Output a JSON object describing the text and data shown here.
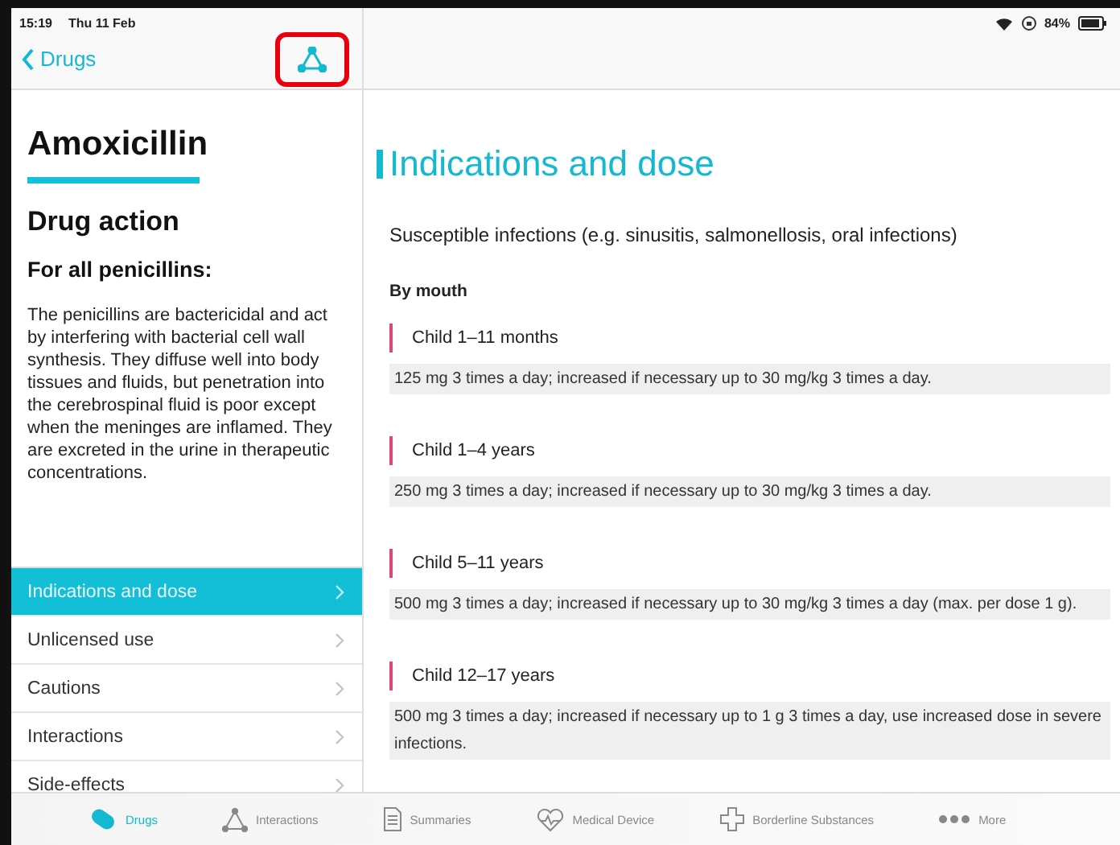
{
  "status_bar": {
    "time": "15:19",
    "date": "Thu 11 Feb",
    "battery": "84%"
  },
  "nav": {
    "back": "Drugs",
    "highlighted": true
  },
  "drug": {
    "name": "Amoxicillin",
    "section_title": "Drug action",
    "subheading": "For all penicillins:",
    "description": "The penicillins are bactericidal and act by interfering with bacterial cell wall synthesis. They diffuse well into body tissues and fluids, but penetration into the cerebrospinal fluid is poor except when the meninges are inflamed. They are excreted in the urine in therapeutic concentrations."
  },
  "sections": [
    {
      "label": "Indications and dose",
      "selected": true
    },
    {
      "label": "Unlicensed use",
      "selected": false
    },
    {
      "label": "Cautions",
      "selected": false
    },
    {
      "label": "Interactions",
      "selected": false
    },
    {
      "label": "Side-effects",
      "selected": false
    }
  ],
  "content": {
    "title": "Indications and dose",
    "indication": "Susceptible infections (e.g. sinusitis, salmonellosis, oral infections)",
    "route": "By mouth",
    "doses": [
      {
        "group": "Child 1–11 months",
        "dose": "125 mg 3 times a day; increased if necessary up to 30 mg/kg 3 times a day."
      },
      {
        "group": "Child 1–4 years",
        "dose": "250 mg 3 times a day; increased if necessary up to 30 mg/kg 3 times a day."
      },
      {
        "group": "Child 5–11 years",
        "dose": "500 mg 3 times a day; increased if necessary up to 30 mg/kg 3 times a day (max. per dose 1 g)."
      },
      {
        "group": "Child 12–17 years",
        "dose": "500 mg 3 times a day; increased if necessary up to 1 g 3 times a day, use increased dose in severe infections."
      }
    ]
  },
  "tab_bar": [
    {
      "label": "Drugs",
      "selected": true
    },
    {
      "label": "Interactions",
      "selected": false
    },
    {
      "label": "Summaries",
      "selected": false
    },
    {
      "label": "Medical Device",
      "selected": false
    },
    {
      "label": "Borderline Substances",
      "selected": false
    },
    {
      "label": "More",
      "selected": false
    }
  ]
}
